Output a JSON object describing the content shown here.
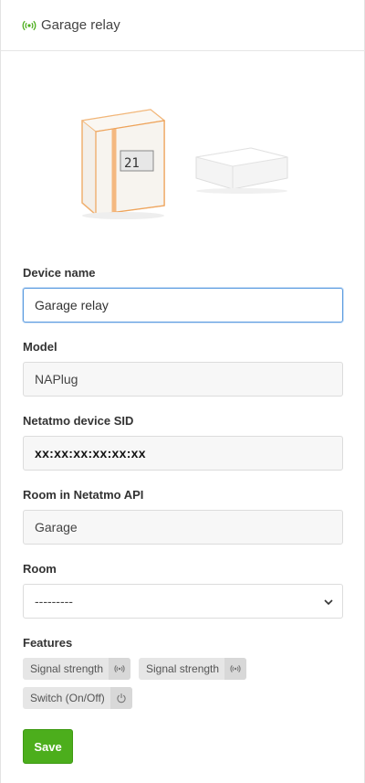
{
  "header": {
    "title": "Garage relay",
    "icon": "signal-icon",
    "icon_color": "#4cae1c"
  },
  "form": {
    "device_name": {
      "label": "Device name",
      "value": "Garage relay"
    },
    "model": {
      "label": "Model",
      "value": "NAPlug"
    },
    "sid": {
      "label": "Netatmo device SID",
      "value": "xx:xx:xx:xx:xx:xx"
    },
    "room_api": {
      "label": "Room in Netatmo API",
      "value": "Garage"
    },
    "room": {
      "label": "Room",
      "selected": "---------"
    },
    "features": {
      "label": "Features",
      "items": [
        {
          "label": "Signal strength",
          "icon": "signal-icon"
        },
        {
          "label": "Signal strength",
          "icon": "signal-icon"
        },
        {
          "label": "Switch (On/Off)",
          "icon": "power-icon"
        }
      ]
    },
    "save_label": "Save"
  },
  "colors": {
    "accent": "#4cae1c",
    "focus_border": "#5a9be0"
  }
}
